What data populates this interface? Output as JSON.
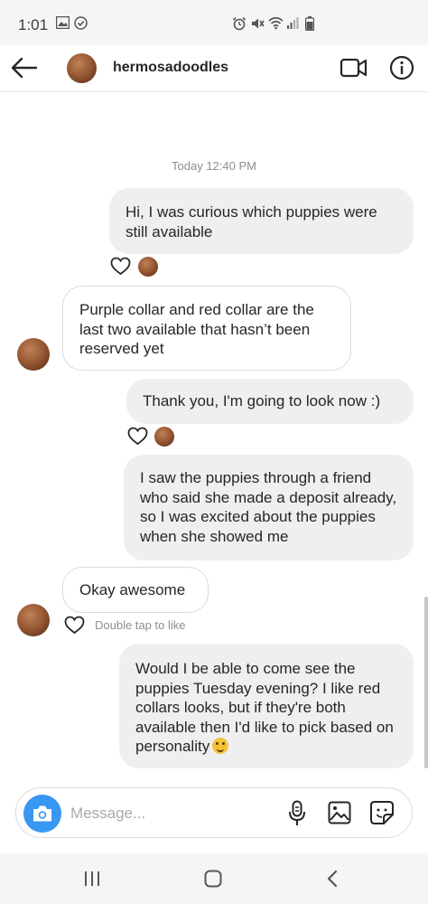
{
  "status_bar": {
    "time": "1:01"
  },
  "header": {
    "username": "hermosadoodles"
  },
  "thread": {
    "timestamp": "Today 12:40 PM",
    "messages": [
      {
        "direction": "out",
        "text": "Hi, I was curious which puppies were still available"
      },
      {
        "direction": "in",
        "text": "Purple collar and red collar are the last two available that hasn’t been reserved yet"
      },
      {
        "direction": "out",
        "text": "Thank you, I'm going to look now :)"
      },
      {
        "direction": "out",
        "text": "I saw the puppies through a friend who said she made a deposit already, so I was excited about the puppies when she showed me"
      },
      {
        "direction": "in",
        "text": "Okay awesome"
      },
      {
        "direction": "out",
        "text": "Would I be able to come see the puppies Tuesday evening?  I like red collars looks, but if they're both available then I'd like to pick based on personality",
        "emoji": "smiling-face-emoji"
      }
    ],
    "double_tap_hint": "Double tap to like"
  },
  "composer": {
    "placeholder": "Message..."
  },
  "colors": {
    "accent": "#3897f0",
    "outgoing_bubble": "#efefef",
    "incoming_border": "#dbdbdb",
    "muted_text": "#8e8e8e"
  },
  "icons": [
    "back-arrow-icon",
    "video-call-icon",
    "info-icon",
    "heart-icon",
    "camera-icon",
    "microphone-icon",
    "gallery-icon",
    "sticker-icon",
    "recent-apps-icon",
    "home-icon",
    "back-icon"
  ]
}
